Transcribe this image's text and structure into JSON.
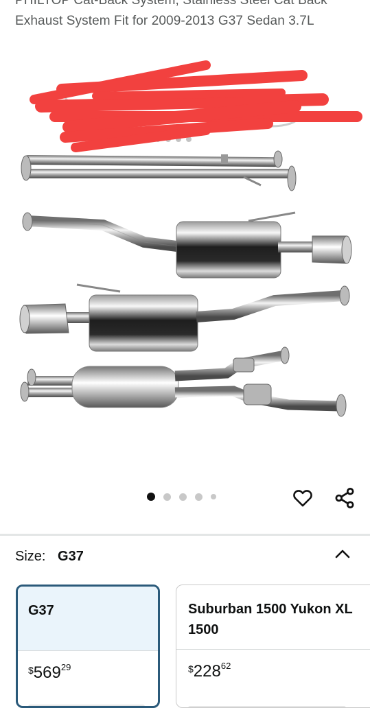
{
  "title": {
    "line1": "PHILTOP Cat-Back System, Stainless Steel Cat Back",
    "line2": "Exhaust System Fit for 2009-2013 G37 Sedan 3.7L"
  },
  "gallery": {
    "image_count": 5,
    "active_index": 0,
    "redaction_color": "#f2413f"
  },
  "actions": {
    "heart_icon": "heart-outline-icon",
    "share_icon": "share-icon"
  },
  "size": {
    "label": "Size:",
    "selected": "G37",
    "collapse_icon": "chevron-up-icon"
  },
  "options": [
    {
      "name": "G37",
      "currency": "$",
      "price_whole": "569",
      "price_fraction": "29",
      "selected": true
    },
    {
      "name": "Suburban 1500 Yukon XL 1500",
      "currency": "$",
      "price_whole": "228",
      "price_fraction": "62",
      "selected": false
    }
  ],
  "colors": {
    "selected_border": "#2b5a7a",
    "selected_bg": "#eaf4fb"
  }
}
